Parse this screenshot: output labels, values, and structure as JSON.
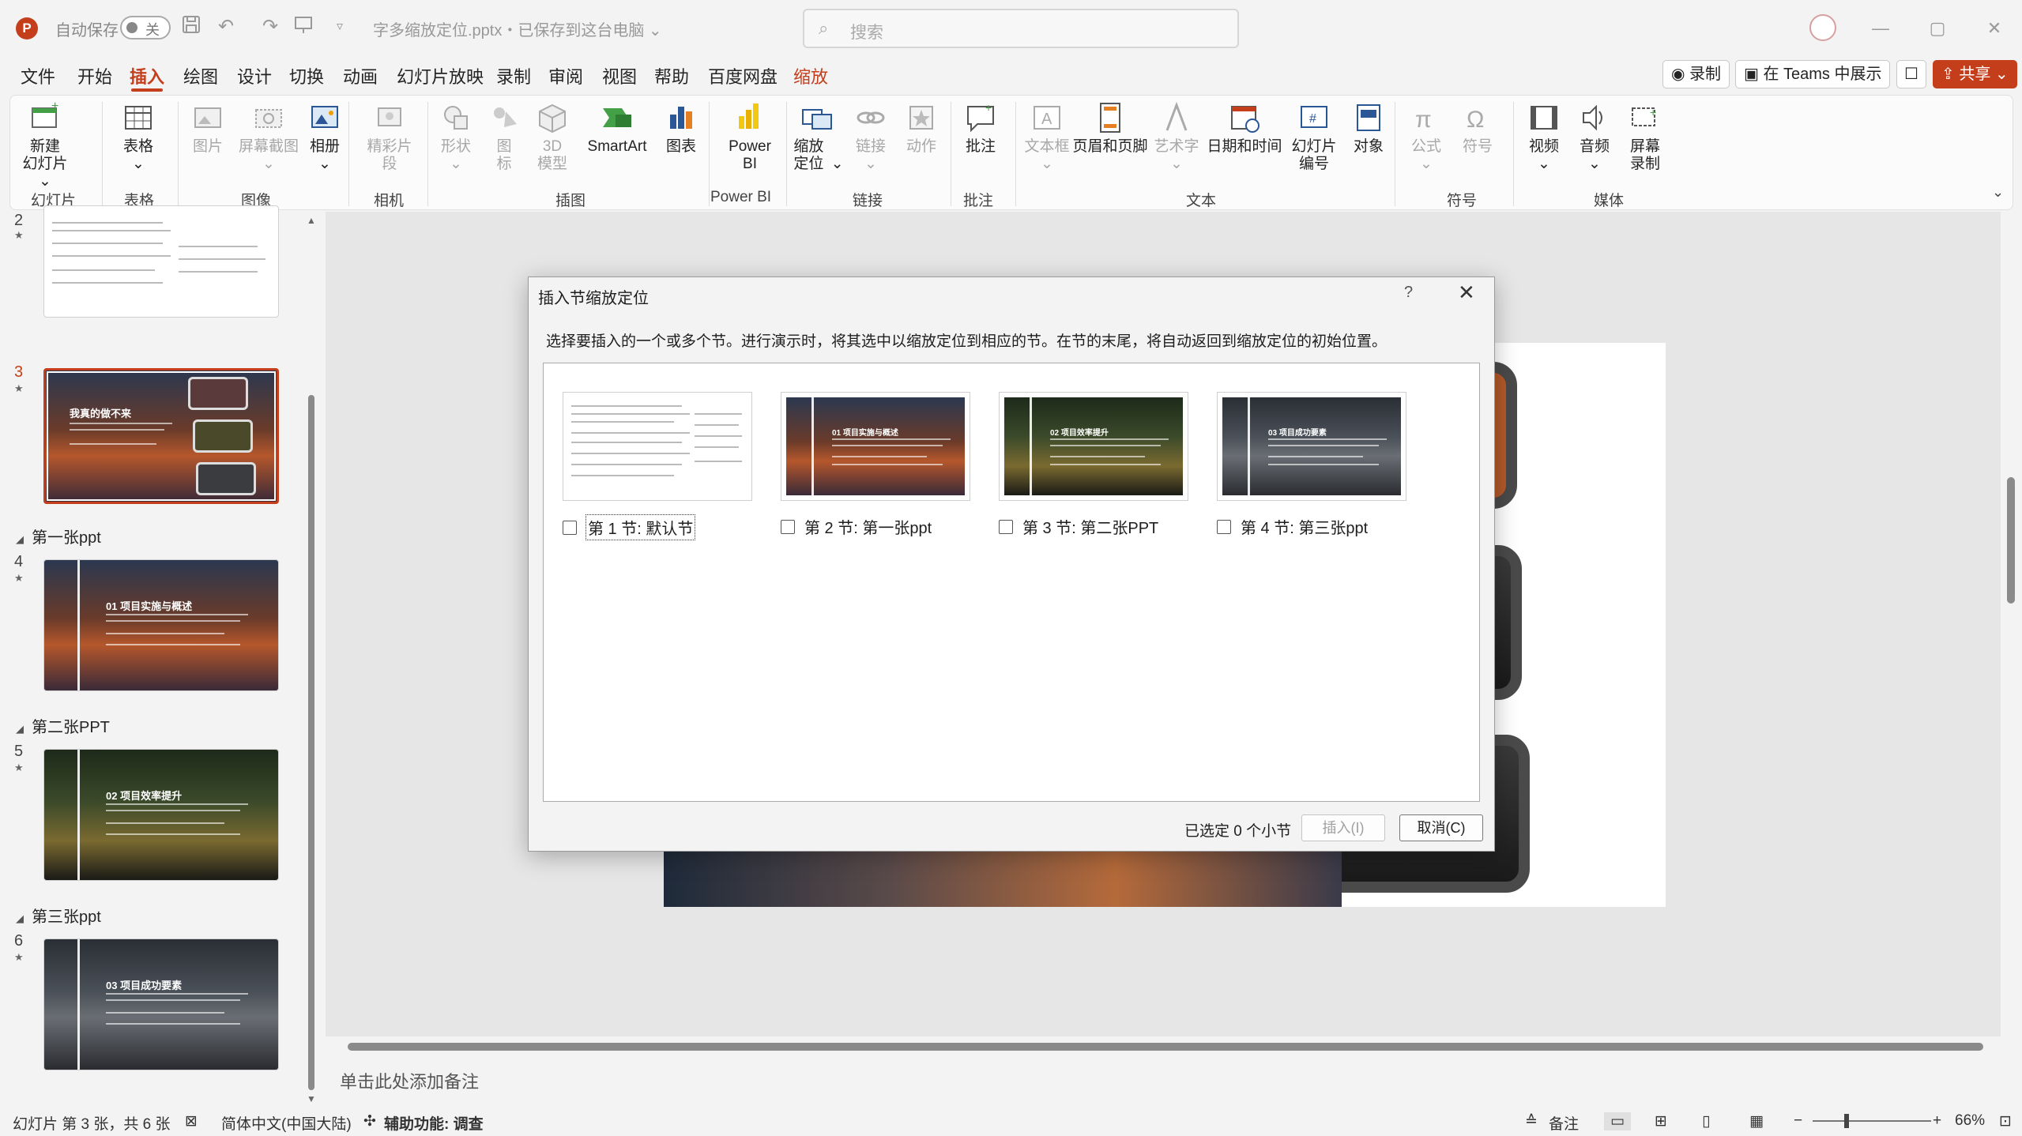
{
  "titlebar": {
    "app_icon": "P",
    "autosave_label": "自动保存",
    "autosave_state": "关",
    "doc_title": "字多缩放定位.pptx・已保存到这台电脑 ⌄",
    "search_placeholder": "搜索",
    "window_controls": [
      "—",
      "▢",
      "✕"
    ]
  },
  "menu": {
    "tabs": [
      "文件",
      "开始",
      "插入",
      "绘图",
      "设计",
      "切换",
      "动画",
      "幻灯片放映",
      "录制",
      "审阅",
      "视图",
      "帮助",
      "百度网盘",
      "缩放"
    ],
    "active_tab": "插入",
    "record_btn": "录制",
    "teams_btn": "在 Teams 中展示",
    "share_btn": "共享"
  },
  "ribbon": {
    "new_slide": "新建\n幻灯片",
    "table": "表格",
    "picture": "图片",
    "screenshot": "屏幕截图",
    "album": "相册",
    "cameo": "精彩片段",
    "shapes": "形状",
    "icons": "图标",
    "model3d": "3D 模型",
    "smartart": "SmartArt",
    "chart": "图表",
    "powerbi": "Power BI",
    "zoom": "缩放定位",
    "link": "链接",
    "action": "动作",
    "comment": "批注",
    "textbox": "文本框",
    "header_footer": "页眉和页脚",
    "wordart": "艺术字",
    "datetime": "日期和时间",
    "slide_number": "幻灯片编号",
    "object": "对象",
    "equation": "公式",
    "symbol": "符号",
    "video": "视频",
    "audio": "音频",
    "screen_record": "屏幕录制",
    "groups": [
      "幻灯片",
      "表格",
      "图像",
      "相机",
      "插图",
      "Power BI",
      "链接",
      "批注",
      "文本",
      "符号",
      "媒体"
    ]
  },
  "thumbnails": {
    "slides": [
      {
        "num": "2",
        "title": ""
      },
      {
        "num": "3",
        "title": "我真的做不来"
      },
      {
        "num": "4",
        "title": "01 项目实施与概述"
      },
      {
        "num": "5",
        "title": "02 项目效率提升"
      },
      {
        "num": "6",
        "title": "03 项目成功要素"
      }
    ],
    "sections": [
      "第一张ppt",
      "第二张PPT",
      "第三张ppt"
    ]
  },
  "notes": {
    "placeholder": "单击此处添加备注"
  },
  "status": {
    "slide_info": "幻灯片 第 3 张，共 6 张",
    "language": "简体中文(中国大陆)",
    "accessibility": "辅助功能: 调查",
    "notes_btn": "备注",
    "zoom_level": "66%"
  },
  "dialog": {
    "title": "插入节缩放定位",
    "help": "?",
    "close": "✕",
    "description": "选择要插入的一个或多个节。进行演示时，将其选中以缩放定位到相应的节。在节的末尾，将自动返回到缩放定位的初始位置。",
    "sections": [
      {
        "label": "第 1 节: 默认节",
        "checked": false,
        "thumb_title": ""
      },
      {
        "label": "第 2 节: 第一张ppt",
        "checked": false,
        "thumb_title": "01 项目实施与概述"
      },
      {
        "label": "第 3 节: 第二张PPT",
        "checked": false,
        "thumb_title": "02 项目效率提升"
      },
      {
        "label": "第 4 节: 第三张ppt",
        "checked": false,
        "thumb_title": "03 项目成功要素"
      }
    ],
    "selected_count": "已选定 0 个小节",
    "insert_btn": "插入(I)",
    "cancel_btn": "取消(C)"
  },
  "colors": {
    "accent": "#c43e1c",
    "ribbon_bg": "#fbfbfb",
    "chrome_bg": "#f3f3f3"
  }
}
